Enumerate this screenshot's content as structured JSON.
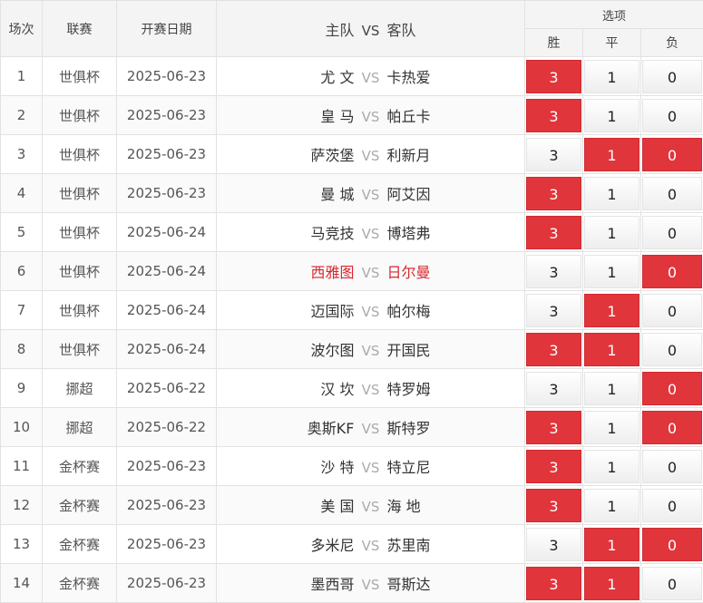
{
  "headers": {
    "num": "场次",
    "league": "联赛",
    "date": "开赛日期",
    "home": "主队",
    "vs": "VS",
    "away": "客队",
    "options": "选项",
    "win": "胜",
    "draw": "平",
    "lose": "负"
  },
  "colors": {
    "selected": "#e0353b",
    "highlight_text": "#d8272f"
  },
  "rows": [
    {
      "num": "1",
      "league": "世俱杯",
      "date": "2025-06-23",
      "home": "尤 文",
      "vs": "VS",
      "away": "卡热爱",
      "w": "3",
      "d": "1",
      "l": "0",
      "sel": [
        true,
        false,
        false
      ],
      "hl": false
    },
    {
      "num": "2",
      "league": "世俱杯",
      "date": "2025-06-23",
      "home": "皇 马",
      "vs": "VS",
      "away": "帕丘卡",
      "w": "3",
      "d": "1",
      "l": "0",
      "sel": [
        true,
        false,
        false
      ],
      "hl": false
    },
    {
      "num": "3",
      "league": "世俱杯",
      "date": "2025-06-23",
      "home": "萨茨堡",
      "vs": "VS",
      "away": "利新月",
      "w": "3",
      "d": "1",
      "l": "0",
      "sel": [
        false,
        true,
        true
      ],
      "hl": false
    },
    {
      "num": "4",
      "league": "世俱杯",
      "date": "2025-06-23",
      "home": "曼 城",
      "vs": "VS",
      "away": "阿艾因",
      "w": "3",
      "d": "1",
      "l": "0",
      "sel": [
        true,
        false,
        false
      ],
      "hl": false
    },
    {
      "num": "5",
      "league": "世俱杯",
      "date": "2025-06-24",
      "home": "马竞技",
      "vs": "VS",
      "away": "博塔弗",
      "w": "3",
      "d": "1",
      "l": "0",
      "sel": [
        true,
        false,
        false
      ],
      "hl": false
    },
    {
      "num": "6",
      "league": "世俱杯",
      "date": "2025-06-24",
      "home": "西雅图",
      "vs": "VS",
      "away": "日尔曼",
      "w": "3",
      "d": "1",
      "l": "0",
      "sel": [
        false,
        false,
        true
      ],
      "hl": true
    },
    {
      "num": "7",
      "league": "世俱杯",
      "date": "2025-06-24",
      "home": "迈国际",
      "vs": "VS",
      "away": "帕尔梅",
      "w": "3",
      "d": "1",
      "l": "0",
      "sel": [
        false,
        true,
        false
      ],
      "hl": false
    },
    {
      "num": "8",
      "league": "世俱杯",
      "date": "2025-06-24",
      "home": "波尔图",
      "vs": "VS",
      "away": "开国民",
      "w": "3",
      "d": "1",
      "l": "0",
      "sel": [
        true,
        true,
        false
      ],
      "hl": false
    },
    {
      "num": "9",
      "league": "挪超",
      "date": "2025-06-22",
      "home": "汉 坎",
      "vs": "VS",
      "away": "特罗姆",
      "w": "3",
      "d": "1",
      "l": "0",
      "sel": [
        false,
        false,
        true
      ],
      "hl": false
    },
    {
      "num": "10",
      "league": "挪超",
      "date": "2025-06-22",
      "home": "奥斯KF",
      "vs": "VS",
      "away": "斯特罗",
      "w": "3",
      "d": "1",
      "l": "0",
      "sel": [
        true,
        false,
        true
      ],
      "hl": false
    },
    {
      "num": "11",
      "league": "金杯赛",
      "date": "2025-06-23",
      "home": "沙 特",
      "vs": "VS",
      "away": "特立尼",
      "w": "3",
      "d": "1",
      "l": "0",
      "sel": [
        true,
        false,
        false
      ],
      "hl": false
    },
    {
      "num": "12",
      "league": "金杯赛",
      "date": "2025-06-23",
      "home": "美 国",
      "vs": "VS",
      "away": "海 地",
      "w": "3",
      "d": "1",
      "l": "0",
      "sel": [
        true,
        false,
        false
      ],
      "hl": false
    },
    {
      "num": "13",
      "league": "金杯赛",
      "date": "2025-06-23",
      "home": "多米尼",
      "vs": "VS",
      "away": "苏里南",
      "w": "3",
      "d": "1",
      "l": "0",
      "sel": [
        false,
        true,
        true
      ],
      "hl": false
    },
    {
      "num": "14",
      "league": "金杯赛",
      "date": "2025-06-23",
      "home": "墨西哥",
      "vs": "VS",
      "away": "哥斯达",
      "w": "3",
      "d": "1",
      "l": "0",
      "sel": [
        true,
        true,
        false
      ],
      "hl": false
    }
  ]
}
